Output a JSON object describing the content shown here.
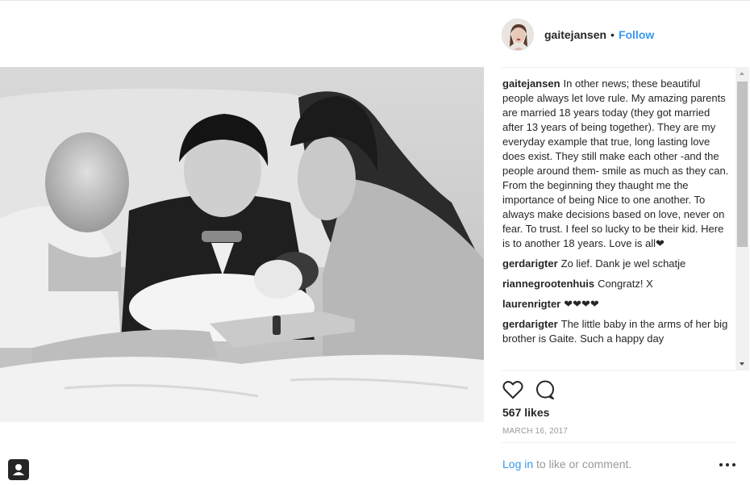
{
  "post": {
    "username": "gaitejansen",
    "dot": "•",
    "follow_label": "Follow",
    "likes": "567 likes",
    "date": "MARCH 16, 2017"
  },
  "comments": [
    {
      "user": "gaitejansen",
      "text": "In other news; these beautiful people always let love rule. My amazing parents are married 18 years today (they got married after 13 years of being together). They are my everyday example that true, long lasting love does exist. They still make each other -and the people around them- smile as much as they can. From the beginning they thaught me the importance of being Nice to one another. To always make decisions based on love, never on fear. To trust. I feel so lucky to be their kid. Here is to another 18 years. Love is all❤"
    },
    {
      "user": "gerdarigter",
      "text": "Zo lief. Dank je wel schatje"
    },
    {
      "user": "riannegrootenhuis",
      "text": "Congratz! X"
    },
    {
      "user": "laurenrigter",
      "text": "❤❤❤❤"
    },
    {
      "user": "gerdarigter",
      "text": "The little baby in the arms of her big brother is Gaite. Such a happy day"
    }
  ],
  "footer": {
    "login_link": "Log in",
    "login_rest": " to like or comment."
  },
  "icons": {
    "like": "heart-icon",
    "comment": "comment-bubble-icon",
    "more": "more-options-icon",
    "user_tag": "user-tag-icon"
  },
  "colors": {
    "link": "#3897f0",
    "text": "#262626",
    "muted": "#999999"
  }
}
